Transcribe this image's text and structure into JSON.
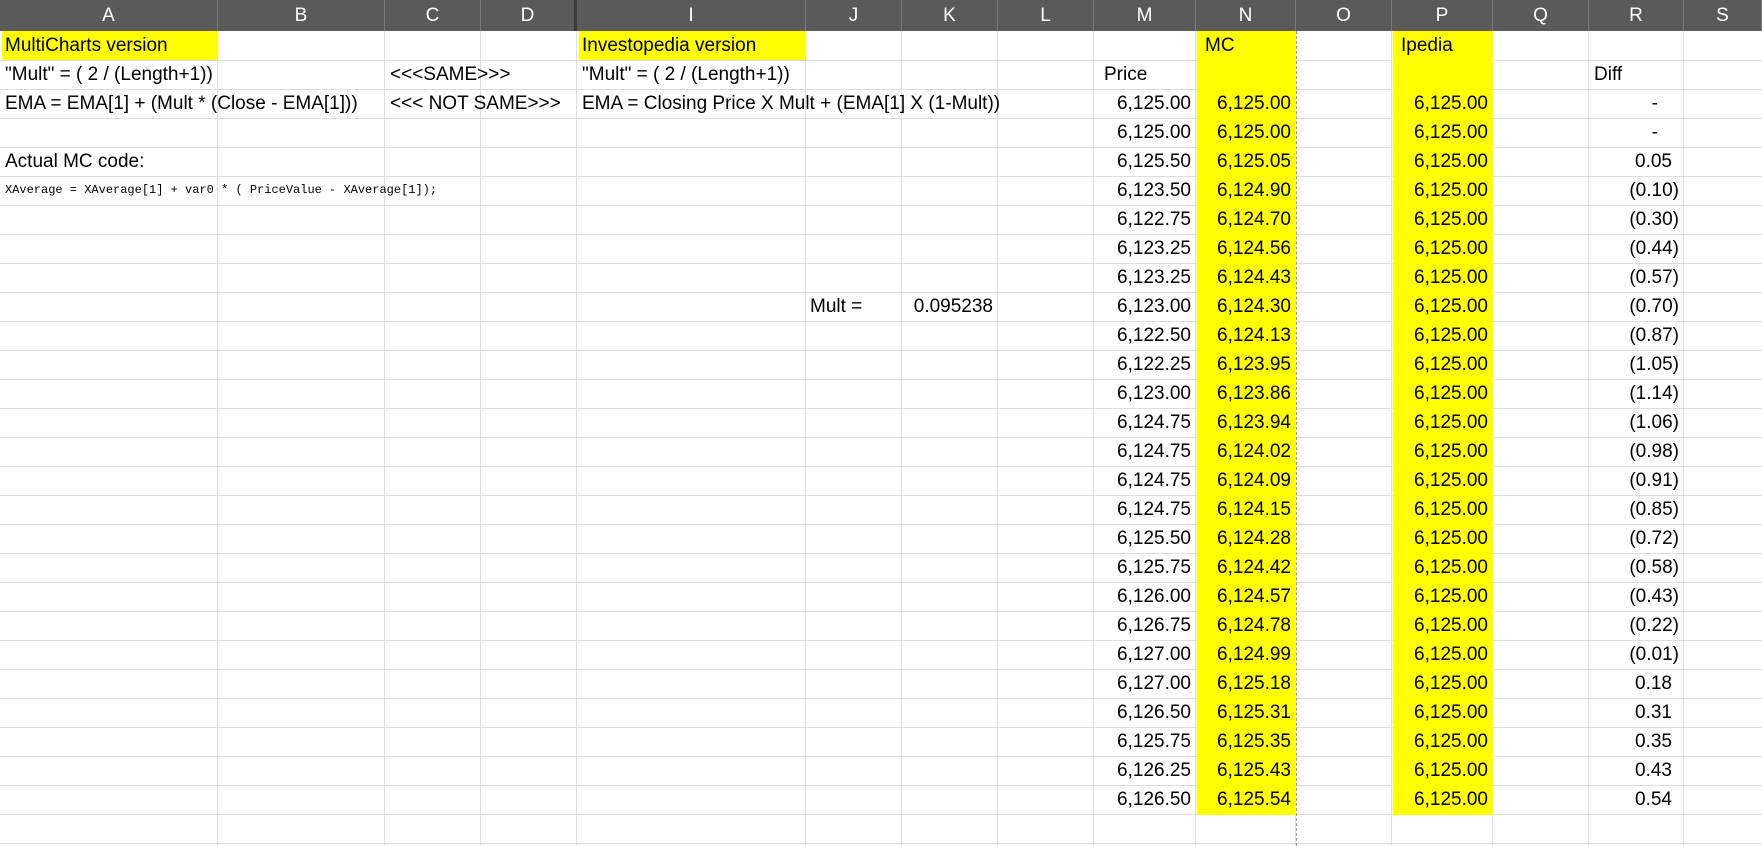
{
  "columns": [
    "A",
    "B",
    "C",
    "D",
    "I",
    "J",
    "K",
    "L",
    "M",
    "N",
    "O",
    "P",
    "Q",
    "R",
    "S"
  ],
  "labels": {
    "multicharts_version": "MultiCharts version",
    "investopedia_version": "Investopedia version",
    "mc_mult_formula": "\"Mult\" = ( 2 / (Length+1))",
    "same": "<<<SAME>>>",
    "ipedia_mult_formula": "\"Mult\" = ( 2 / (Length+1))",
    "mc_ema_formula": "EMA = EMA[1] + (Mult * (Close - EMA[1]))",
    "not_same": "<<< NOT SAME>>>",
    "ipedia_ema_formula": "EMA = Closing Price X Mult + (EMA[1] X (1-Mult))",
    "actual_mc_code": "Actual MC code:",
    "mc_code_line": "XAverage = XAverage[1] + var0 * ( PriceValue - XAverage[1]);",
    "mult_label": "Mult =",
    "mult_value": "0.095238",
    "header_mc": "MC",
    "header_ipedia": "Ipedia",
    "header_price": "Price",
    "header_diff": "Diff"
  },
  "table": {
    "price": [
      "6,125.00",
      "6,125.00",
      "6,125.50",
      "6,123.50",
      "6,122.75",
      "6,123.25",
      "6,123.25",
      "6,123.00",
      "6,122.50",
      "6,122.25",
      "6,123.00",
      "6,124.75",
      "6,124.75",
      "6,124.75",
      "6,124.75",
      "6,125.50",
      "6,125.75",
      "6,126.00",
      "6,126.75",
      "6,127.00",
      "6,127.00",
      "6,126.50",
      "6,125.75",
      "6,126.25",
      "6,126.50"
    ],
    "mc": [
      "6,125.00",
      "6,125.00",
      "6,125.05",
      "6,124.90",
      "6,124.70",
      "6,124.56",
      "6,124.43",
      "6,124.30",
      "6,124.13",
      "6,123.95",
      "6,123.86",
      "6,123.94",
      "6,124.02",
      "6,124.09",
      "6,124.15",
      "6,124.28",
      "6,124.42",
      "6,124.57",
      "6,124.78",
      "6,124.99",
      "6,125.18",
      "6,125.31",
      "6,125.35",
      "6,125.43",
      "6,125.54"
    ],
    "ipedia": [
      "6,125.00",
      "6,125.00",
      "6,125.00",
      "6,125.00",
      "6,125.00",
      "6,125.00",
      "6,125.00",
      "6,125.00",
      "6,125.00",
      "6,125.00",
      "6,125.00",
      "6,125.00",
      "6,125.00",
      "6,125.00",
      "6,125.00",
      "6,125.00",
      "6,125.00",
      "6,125.00",
      "6,125.00",
      "6,125.00",
      "6,125.00",
      "6,125.00",
      "6,125.00",
      "6,125.00",
      "6,125.00"
    ],
    "diff": [
      "-",
      "-",
      "0.05",
      "(0.10)",
      "(0.30)",
      "(0.44)",
      "(0.57)",
      "(0.70)",
      "(0.87)",
      "(1.05)",
      "(1.14)",
      "(1.06)",
      "(0.98)",
      "(0.91)",
      "(0.85)",
      "(0.72)",
      "(0.58)",
      "(0.43)",
      "(0.22)",
      "(0.01)",
      "0.18",
      "0.31",
      "0.35",
      "0.43",
      "0.54"
    ]
  },
  "colors": {
    "highlight": "#ffff00",
    "header_bg": "#5a5a5a",
    "gridline": "#dedede"
  }
}
